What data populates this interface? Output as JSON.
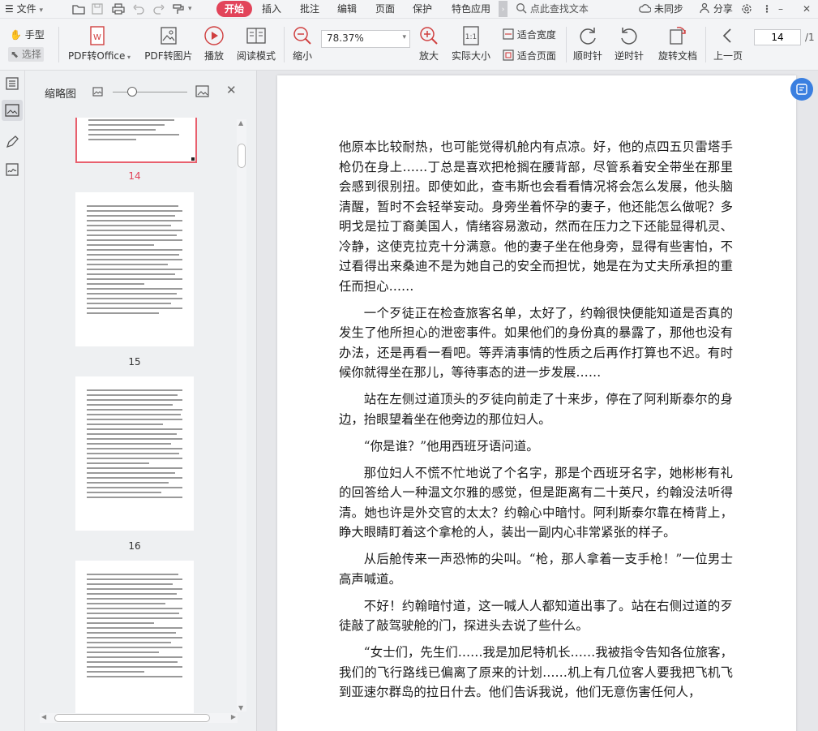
{
  "menubar": {
    "file_label": "文件",
    "tabs": [
      "开始",
      "插入",
      "批注",
      "编辑",
      "页面",
      "保护",
      "特色应用"
    ],
    "search_placeholder": "点此查找文本",
    "sync_label": "未同步",
    "share_label": "分享"
  },
  "toolbar": {
    "hand_label": "手型",
    "select_label": "选择",
    "pdf_to_office": "PDF转Office",
    "pdf_to_image": "PDF转图片",
    "play": "播放",
    "read_mode": "阅读模式",
    "zoom_out": "缩小",
    "zoom_value": "78.37%",
    "zoom_in": "放大",
    "actual_size": "实际大小",
    "fit_width": "适合宽度",
    "fit_page": "适合页面",
    "rotate_cw": "顺时针",
    "rotate_ccw": "逆时针",
    "rotate_doc": "旋转文档",
    "prev_page": "上一页",
    "page_input": "14",
    "page_total": "/1"
  },
  "thumbnails": {
    "title": "缩略图",
    "pages": [
      "14",
      "15",
      "16"
    ]
  },
  "document": {
    "paragraphs": [
      "他原本比较耐热，也可能觉得机舱内有点凉。好，他的点四五贝雷塔手枪仍在身上……丁总是喜欢把枪搁在腰背部，尽管系着安全带坐在那里会感到很别扭。即使如此，查韦斯也会看看情况将会怎么发展，他头脑清醒，暂时不会轻举妄动。身旁坐着怀孕的妻子，他还能怎么做呢？多明戈是拉丁裔美国人，情绪容易激动，然而在压力之下还能显得机灵、冷静，这使克拉克十分满意。他的妻子坐在他身旁，显得有些害怕，不过看得出来桑迪不是为她自己的安全而担忧，她是在为丈夫所承担的重任而担心……",
      "一个歹徒正在检查旅客名单，太好了，约翰很快便能知道是否真的发生了他所担心的泄密事件。如果他们的身份真的暴露了，那他也没有办法，还是再看一看吧。等弄清事情的性质之后再作打算也不迟。有时候你就得坐在那儿，等待事态的进一步发展……",
      "站在左侧过道顶头的歹徒向前走了十来步，停在了阿利斯泰尔的身边，抬眼望着坐在他旁边的那位妇人。",
      "“你是谁？”他用西班牙语问道。",
      "那位妇人不慌不忙地说了个名字，那是个西班牙名字，她彬彬有礼的回答给人一种温文尔雅的感觉，但是距离有二十英尺，约翰没法听得清。她也许是外交官的太太？约翰心中暗忖。阿利斯泰尔靠在椅背上，睁大眼睛盯着这个拿枪的人，装出一副内心非常紧张的样子。",
      "从后舱传来一声恐怖的尖叫。“枪，那人拿着一支手枪！”一位男士高声喊道。",
      "不好！约翰暗忖道，这一喊人人都知道出事了。站在右侧过道的歹徒敲了敲驾驶舱的门，探进头去说了些什么。",
      "“女士们，先生们……我是加尼特机长……我被指令告知各位旅客，我们的飞行路线已偏离了原来的计划……机上有几位客人要我把飞机飞到亚速尔群岛的拉日什去。他们告诉我说，他们无意伤害任何人，"
    ]
  },
  "colors": {
    "accent": "#e2445a",
    "toolbar_bg": "#f3f4f6",
    "float_button": "#3a7fe0"
  }
}
